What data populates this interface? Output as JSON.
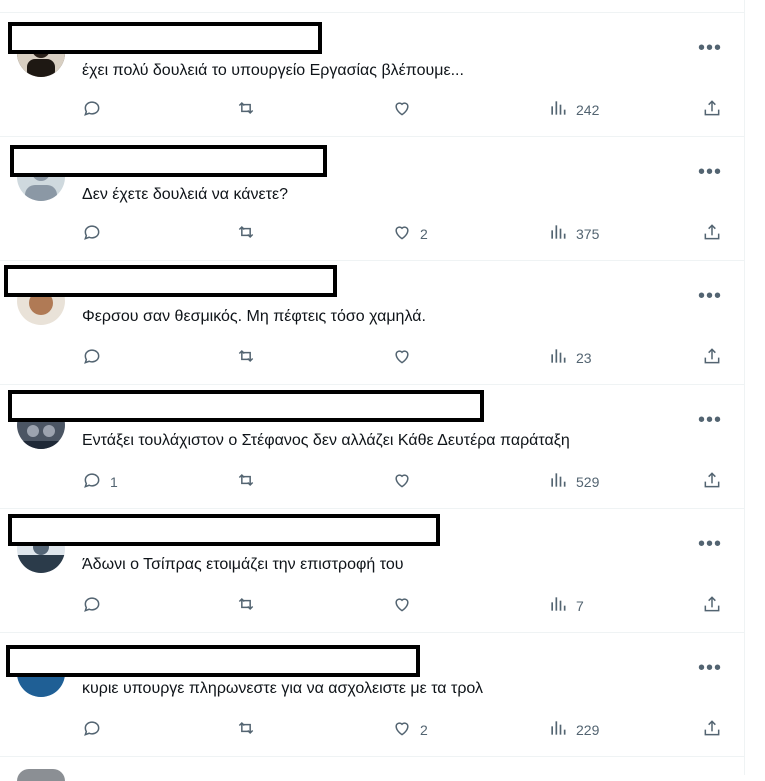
{
  "replies": [
    {
      "text": "έχει πολύ δουλειά το υπουργείο Εργασίας βλέπουμε...",
      "replies_count": "",
      "likes_count": "",
      "views": "242",
      "avatar_color": "#4a3a2e"
    },
    {
      "text": "Δεν έχετε δουλειά να κάνετε?",
      "replies_count": "",
      "likes_count": "2",
      "views": "375",
      "avatar_color": "#c9d1d9"
    },
    {
      "text": "Φερσου σαν θεσμικός. Μη πέφτεις τόσο χαμηλά.",
      "replies_count": "",
      "likes_count": "",
      "views": "23",
      "avatar_color": "#a0684a"
    },
    {
      "text": "Εντάξει τουλάχιστον ο Στέφανος δεν αλλάζει Κάθε Δευτέρα παράταξη",
      "replies_count": "1",
      "likes_count": "",
      "views": "529",
      "avatar_color": "#3b4550"
    },
    {
      "text": "Άδωνι ο Τσίπρας ετοιμάζει την επιστροφή του",
      "replies_count": "",
      "likes_count": "",
      "views": "7",
      "avatar_color": "#5a6a7a"
    },
    {
      "text": "κυριε υπουργε πληρωνεστε για να ασχολειστε με τα τρολ",
      "replies_count": "",
      "likes_count": "2",
      "views": "229",
      "avatar_color": "#2d6fa3"
    }
  ],
  "icons": {
    "reply": "reply-icon",
    "retweet": "retweet-icon",
    "like": "like-icon",
    "views": "views-icon",
    "share": "share-icon",
    "more": "more-icon"
  },
  "more_glyph": "•••"
}
